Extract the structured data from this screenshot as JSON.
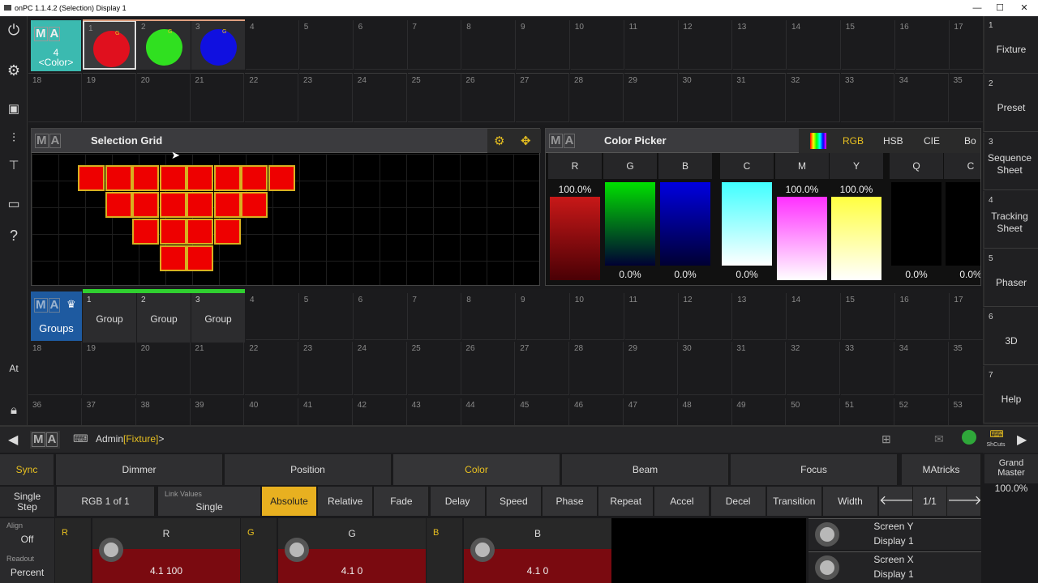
{
  "window": {
    "title": "onPC 1.1.4.2 (Selection) Display 1",
    "min": "—",
    "max": "☐",
    "close": "✕"
  },
  "leftbar": [
    "power-icon",
    "gear-icon",
    "book-icon",
    "faders-icon",
    "stage-icon",
    "monitor-icon",
    "help-icon",
    "At",
    "lock-icon"
  ],
  "leftbar_at": "At",
  "colorpool": {
    "header_num": "4",
    "header_label": "<Color>",
    "items": [
      {
        "num": "1",
        "color": "#e0101e"
      },
      {
        "num": "2",
        "color": "#30e020"
      },
      {
        "num": "3",
        "color": "#1010e0"
      }
    ],
    "row1": [
      "4",
      "5",
      "6",
      "7",
      "8",
      "9",
      "10",
      "11",
      "12",
      "13",
      "14",
      "15",
      "16",
      "17"
    ],
    "row2": [
      "18",
      "19",
      "20",
      "21",
      "22",
      "23",
      "24",
      "25",
      "26",
      "27",
      "28",
      "29",
      "30",
      "31",
      "32",
      "33",
      "34",
      "35"
    ]
  },
  "selection_grid": {
    "title": "Selection Grid"
  },
  "color_picker": {
    "title": "Color Picker",
    "tabs": [
      "RGB",
      "HSB",
      "CIE",
      "Bo"
    ],
    "bars": [
      {
        "label": "R",
        "top": "100.0%",
        "bottom": "",
        "color": "#e00000"
      },
      {
        "label": "G",
        "top": "",
        "bottom": "0.0%",
        "color": "#00e000"
      },
      {
        "label": "B",
        "top": "",
        "bottom": "0.0%",
        "color": "#0000e0"
      },
      {
        "label": "C",
        "top": "",
        "bottom": "0.0%",
        "color": "#40ffff"
      },
      {
        "label": "M",
        "top": "100.0%",
        "bottom": "",
        "color": "#ff30ff"
      },
      {
        "label": "Y",
        "top": "100.0%",
        "bottom": "",
        "color": "#ffff40"
      },
      {
        "label": "Q",
        "top": "",
        "bottom": "0.0%",
        "color": "#000"
      },
      {
        "label": "C",
        "top": "",
        "bottom": "0.0%",
        "color": "#000"
      }
    ]
  },
  "groups": {
    "title": "Groups",
    "items": [
      {
        "num": "1",
        "label": "Group"
      },
      {
        "num": "2",
        "label": "Group"
      },
      {
        "num": "3",
        "label": "Group"
      }
    ],
    "row1": [
      "4",
      "5",
      "6",
      "7",
      "8",
      "9",
      "10",
      "11",
      "12",
      "13",
      "14",
      "15",
      "16",
      "17"
    ],
    "row2": [
      "18",
      "19",
      "20",
      "21",
      "22",
      "23",
      "24",
      "25",
      "26",
      "27",
      "28",
      "29",
      "30",
      "31",
      "32",
      "33",
      "34",
      "35"
    ],
    "row3": [
      "36",
      "37",
      "38",
      "39",
      "40",
      "41",
      "42",
      "43",
      "44",
      "45",
      "46",
      "47",
      "48",
      "49",
      "50",
      "51",
      "52",
      "53"
    ]
  },
  "rightbar": [
    {
      "n": "1",
      "label": "Fixture"
    },
    {
      "n": "2",
      "label": "Preset"
    },
    {
      "n": "3",
      "label": "Sequence Sheet"
    },
    {
      "n": "4",
      "label": "Tracking Sheet"
    },
    {
      "n": "5",
      "label": "Phaser"
    },
    {
      "n": "6",
      "label": "3D"
    },
    {
      "n": "7",
      "label": "Help"
    }
  ],
  "commandline": {
    "prompt_user": "Admin",
    "prompt_dest": "[Fixture]",
    "suffix": ">",
    "shcuts": "ShCuts"
  },
  "featurebar": {
    "sync": "Sync",
    "features": [
      "Dimmer",
      "Position",
      "Color",
      "Beam",
      "Focus"
    ],
    "matricks": "MAtricks",
    "grand_master": "Grand Master",
    "gm_value": "100.0%"
  },
  "subbar": {
    "single_step": "Single Step",
    "rgb": "RGB 1 of 1",
    "link_values_label": "Link Values",
    "link_values": "Single",
    "modes": [
      "Absolute",
      "Relative",
      "Fade",
      "Delay",
      "Speed",
      "Phase",
      "Repeat",
      "Accel",
      "Decel",
      "Transition",
      "Width"
    ],
    "page": "1/1"
  },
  "encoders": {
    "align_label": "Align",
    "align": "Off",
    "readout_label": "Readout",
    "readout": "Percent",
    "items": [
      {
        "tag": "R",
        "label": "R",
        "value": "4.1  100"
      },
      {
        "tag": "G",
        "label": "G",
        "value": "4.1  0"
      },
      {
        "tag": "B",
        "label": "B",
        "value": "4.1  0"
      }
    ],
    "screen": [
      {
        "a": "Screen Y",
        "b": "Display 1"
      },
      {
        "a": "Screen X",
        "b": "Display 1"
      }
    ]
  }
}
